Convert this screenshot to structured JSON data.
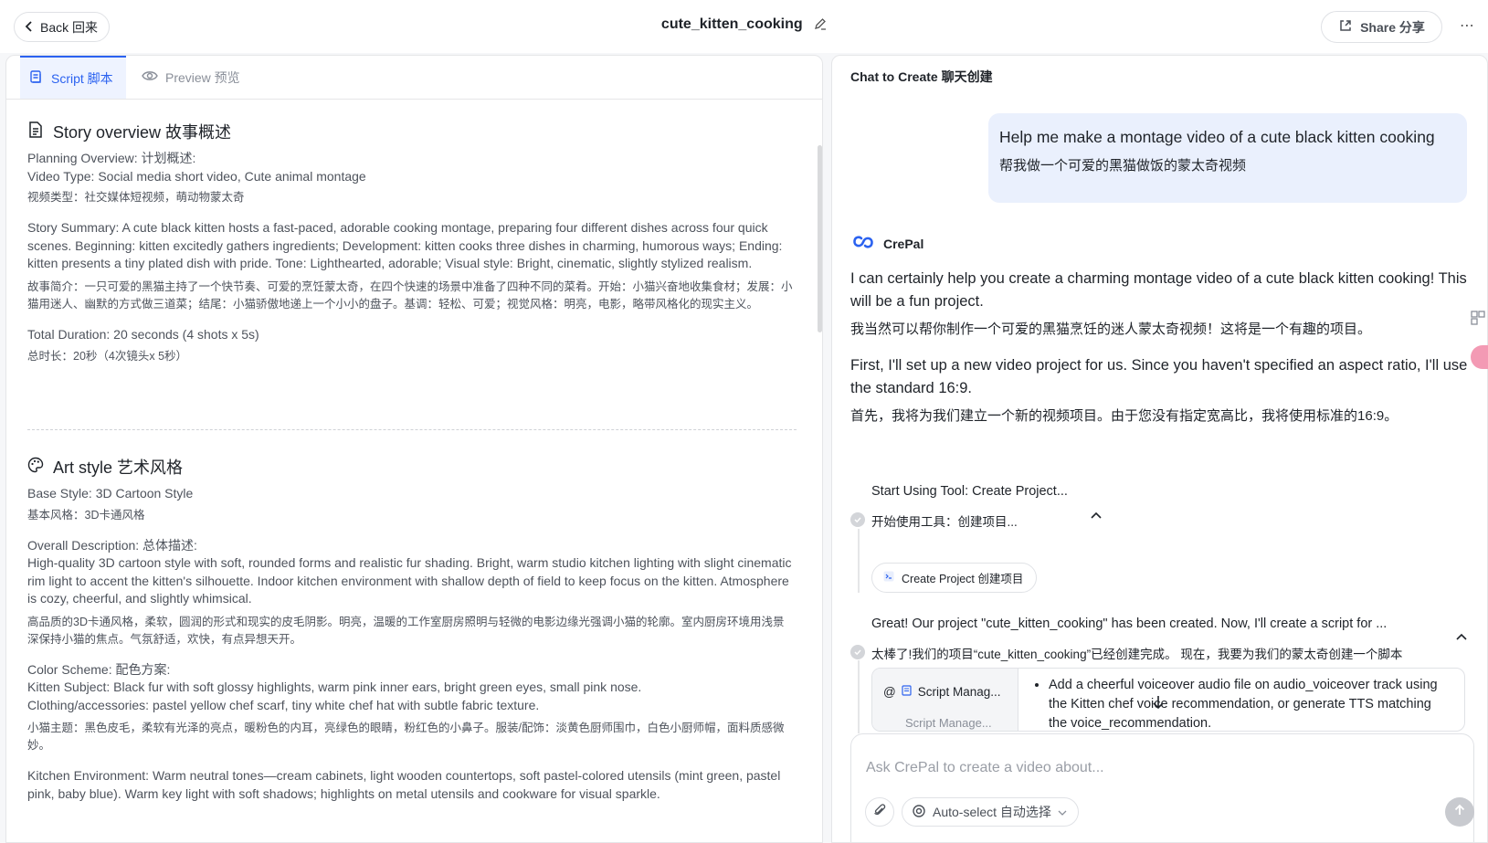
{
  "header": {
    "back_label": "Back 回来",
    "title": "cute_kitten_cooking",
    "share_label": "Share 分享",
    "more": "⋯"
  },
  "tabs": [
    {
      "label": "Script 脚本",
      "active": true
    },
    {
      "label": "Preview 预览",
      "active": false
    }
  ],
  "story": {
    "heading": "Story overview 故事概述",
    "planning": "Planning Overview: 计划概述:",
    "video_type_en": "Video Type: Social media short video, Cute animal montage",
    "video_type_zh": "视频类型：社交媒体短视频，萌动物蒙太奇",
    "summary_en": "Story Summary: A cute black kitten hosts a fast-paced, adorable cooking montage, preparing four different dishes across four quick scenes. Beginning: kitten excitedly gathers ingredients; Development: kitten cooks three dishes in charming, humorous ways; Ending: kitten presents a tiny plated dish with pride. Tone: Lighthearted, adorable; Visual style: Bright, cinematic, slightly stylized realism.",
    "summary_zh": "故事简介：一只可爱的黑猫主持了一个快节奏、可爱的烹饪蒙太奇，在四个快速的场景中准备了四种不同的菜肴。开始：小猫兴奋地收集食材；发展：小猫用迷人、幽默的方式做三道菜；结尾：小猫骄傲地递上一个小小的盘子。基调：轻松、可爱；视觉风格：明亮，电影，略带风格化的现实主义。",
    "duration_en": "Total Duration: 20 seconds (4 shots x 5s)",
    "duration_zh": "总时长：20秒（4次镜头x 5秒）"
  },
  "art": {
    "heading": "Art style 艺术风格",
    "base_en": "Base Style: 3D Cartoon Style",
    "base_zh": "基本风格：3D卡通风格",
    "overall_label": "Overall Description: 总体描述:",
    "overall_en": "High-quality 3D cartoon style with soft, rounded forms and realistic fur shading. Bright, warm studio kitchen lighting with slight cinematic rim light to accent the kitten's silhouette. Indoor kitchen environment with shallow depth of field to keep focus on the kitten. Atmosphere is cozy, cheerful, and slightly whimsical.",
    "overall_zh": "高品质的3D卡通风格，柔软，圆润的形式和现实的皮毛阴影。明亮，温暖的工作室厨房照明与轻微的电影边缘光强调小猫的轮廓。室内厨房环境用浅景深保持小猫的焦点。气氛舒适，欢快，有点异想天开。",
    "color_label": "Color Scheme: 配色方案:",
    "color_en_1": "Kitten Subject: Black fur with soft glossy highlights, warm pink inner ears, bright green eyes, small pink nose.",
    "color_en_2": "Clothing/accessories: pastel yellow chef scarf, tiny white chef hat with subtle fabric texture.",
    "color_zh": "小猫主题：黑色皮毛，柔软有光泽的亮点，暖粉色的内耳，亮绿色的眼睛，粉红色的小鼻子。服装/配饰：淡黄色厨师围巾，白色小厨师帽，面料质感微妙。",
    "kitchen_en": "Kitchen Environment: Warm neutral tones—cream cabinets, light wooden countertops, soft pastel-colored utensils (mint green, pastel pink, baby blue). Warm key light with soft shadows; highlights on metal utensils and cookware for visual sparkle."
  },
  "chat": {
    "heading": "Chat to Create 聊天创建",
    "user_en": "Help me make a montage video of a cute black kitten cooking",
    "user_zh": "帮我做一个可爱的黑猫做饭的蒙太奇视频",
    "bot_name": "CrePal",
    "msg1_en": "I can certainly help you create a charming montage video of a cute black kitten cooking! This will be a fun project.",
    "msg1_zh": "我当然可以帮你制作一个可爱的黑猫烹饪的迷人蒙太奇视频！这将是一个有趣的项目。",
    "msg2_en": "First, I'll set up a new video project for us. Since you haven't specified an aspect ratio, I'll use the standard 16:9.",
    "msg2_zh": "首先，我将为我们建立一个新的视频项目。由于您没有指定宽高比，我将使用标准的16:9。",
    "step1_en": "Start Using Tool: Create Project...",
    "step1_zh": "开始使用工具：创建项目...",
    "pill_label": "Create Project 创建项目",
    "step2_en": "Great! Our project \"cute_kitten_cooking\" has been created. Now, I'll create a script for ...",
    "step2_zh": "太棒了!我们的项目“cute_kitten_cooking”已经创建完成。 现在，我要为我们的蒙太奇创建一个脚本",
    "card_left_1": "Script Manag...",
    "card_left_2": "Script Manage...",
    "card_item": "Add a cheerful voiceover audio file on audio_voiceover track using the Kitten chef voice recommendation, or generate TTS matching the voice_recommendation.",
    "input_placeholder": "Ask CrePal to create a video about...",
    "model_label": "Auto-select 自动选择"
  },
  "colors": {
    "accent": "#2b62f0",
    "user_bubble": "#eaf0fd"
  }
}
